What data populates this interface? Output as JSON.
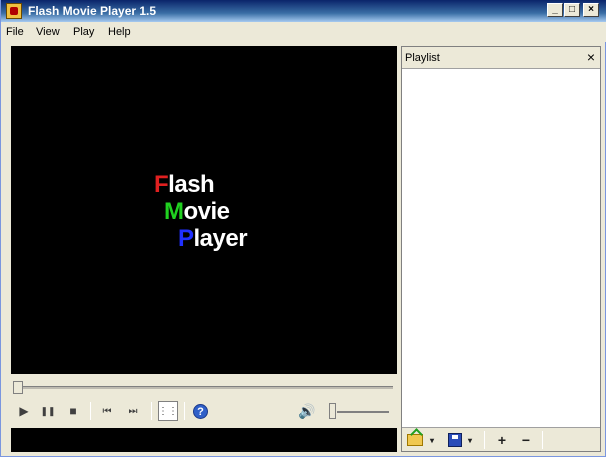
{
  "window": {
    "title": "Flash Movie Player 1.5",
    "min_glyph": "_",
    "max_glyph": "□",
    "close_glyph": "×"
  },
  "menu": [
    "File",
    "View",
    "Play",
    "Help"
  ],
  "video": {
    "logo_lines": [
      {
        "initial": "F",
        "rest": "lash"
      },
      {
        "initial": "M",
        "rest": "ovie"
      },
      {
        "initial": "P",
        "rest": "layer"
      }
    ]
  },
  "seek": {
    "position": 0
  },
  "controls": {
    "play_icon": "▶",
    "pause_icon": "❚❚",
    "stop_icon": "■",
    "prev_icon": "⏮",
    "next_icon": "⏭",
    "playlist_icon": "⋮⋮",
    "help_icon": "?",
    "volume_icon": "🔊",
    "volume_level": 0
  },
  "playlist": {
    "title": "Playlist",
    "close_glyph": "×",
    "items": [],
    "toolbar": {
      "add_glyph": "+",
      "remove_glyph": "−",
      "caret": "▾"
    }
  },
  "colors": {
    "title_gradient_start": "#0a246a",
    "title_gradient_end": "#a6caf0",
    "logo_red": "#e02020",
    "logo_green": "#20d020",
    "logo_blue": "#2030ff"
  }
}
